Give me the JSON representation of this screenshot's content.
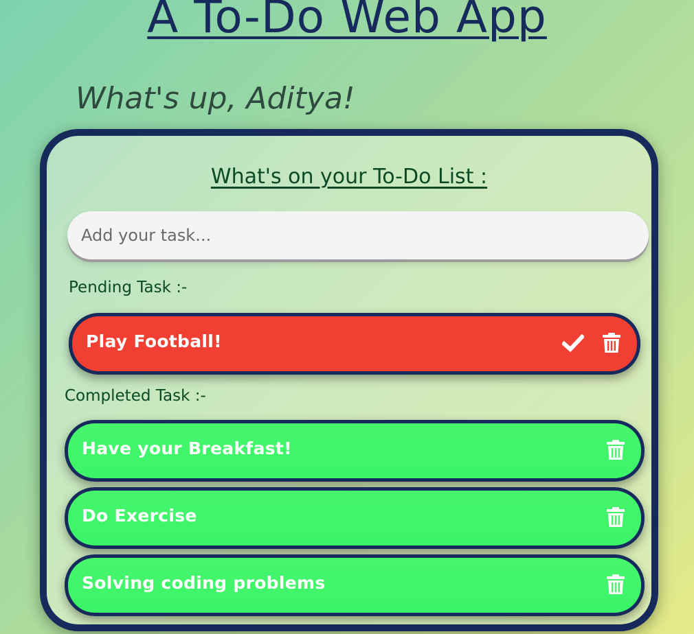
{
  "header": {
    "title": "A To-Do Web App",
    "greeting": "What's up, Aditya!"
  },
  "card": {
    "heading": "What's on your To-Do List :",
    "input_placeholder": "Add your task...",
    "input_value": ""
  },
  "pending": {
    "label": "Pending Task :-",
    "tasks": [
      {
        "text": "Play Football!",
        "color": "#f13f33",
        "actions": [
          "check-icon",
          "trash-icon"
        ]
      }
    ]
  },
  "completed": {
    "label": "Completed Task :-",
    "tasks": [
      {
        "text": "Have your Breakfast!",
        "color": "#46f56c",
        "actions": [
          "trash-icon"
        ]
      },
      {
        "text": "Do Exercise",
        "color": "#46f56c",
        "actions": [
          "trash-icon"
        ]
      },
      {
        "text": "Solving coding problems",
        "color": "#46f56c",
        "actions": [
          "trash-icon"
        ]
      }
    ]
  },
  "colors": {
    "border": "#162b5c",
    "heading_green": "#0c4a25",
    "pending_red": "#f13f33",
    "completed_green": "#46f56c"
  }
}
